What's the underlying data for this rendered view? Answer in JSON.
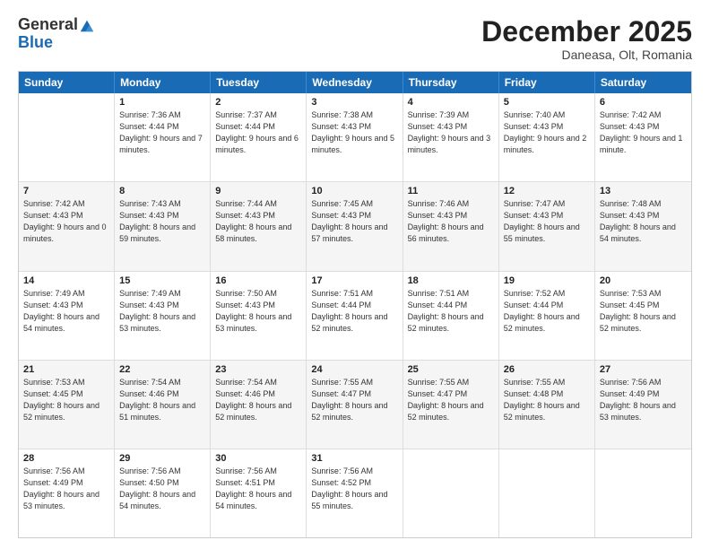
{
  "header": {
    "logo_general": "General",
    "logo_blue": "Blue",
    "month_title": "December 2025",
    "location": "Daneasa, Olt, Romania"
  },
  "days_of_week": [
    "Sunday",
    "Monday",
    "Tuesday",
    "Wednesday",
    "Thursday",
    "Friday",
    "Saturday"
  ],
  "weeks": [
    [
      {
        "day": "",
        "sunrise": "",
        "sunset": "",
        "daylight": ""
      },
      {
        "day": "1",
        "sunrise": "Sunrise: 7:36 AM",
        "sunset": "Sunset: 4:44 PM",
        "daylight": "Daylight: 9 hours and 7 minutes."
      },
      {
        "day": "2",
        "sunrise": "Sunrise: 7:37 AM",
        "sunset": "Sunset: 4:44 PM",
        "daylight": "Daylight: 9 hours and 6 minutes."
      },
      {
        "day": "3",
        "sunrise": "Sunrise: 7:38 AM",
        "sunset": "Sunset: 4:43 PM",
        "daylight": "Daylight: 9 hours and 5 minutes."
      },
      {
        "day": "4",
        "sunrise": "Sunrise: 7:39 AM",
        "sunset": "Sunset: 4:43 PM",
        "daylight": "Daylight: 9 hours and 3 minutes."
      },
      {
        "day": "5",
        "sunrise": "Sunrise: 7:40 AM",
        "sunset": "Sunset: 4:43 PM",
        "daylight": "Daylight: 9 hours and 2 minutes."
      },
      {
        "day": "6",
        "sunrise": "Sunrise: 7:42 AM",
        "sunset": "Sunset: 4:43 PM",
        "daylight": "Daylight: 9 hours and 1 minute."
      }
    ],
    [
      {
        "day": "7",
        "sunrise": "Sunrise: 7:42 AM",
        "sunset": "Sunset: 4:43 PM",
        "daylight": "Daylight: 9 hours and 0 minutes."
      },
      {
        "day": "8",
        "sunrise": "Sunrise: 7:43 AM",
        "sunset": "Sunset: 4:43 PM",
        "daylight": "Daylight: 8 hours and 59 minutes."
      },
      {
        "day": "9",
        "sunrise": "Sunrise: 7:44 AM",
        "sunset": "Sunset: 4:43 PM",
        "daylight": "Daylight: 8 hours and 58 minutes."
      },
      {
        "day": "10",
        "sunrise": "Sunrise: 7:45 AM",
        "sunset": "Sunset: 4:43 PM",
        "daylight": "Daylight: 8 hours and 57 minutes."
      },
      {
        "day": "11",
        "sunrise": "Sunrise: 7:46 AM",
        "sunset": "Sunset: 4:43 PM",
        "daylight": "Daylight: 8 hours and 56 minutes."
      },
      {
        "day": "12",
        "sunrise": "Sunrise: 7:47 AM",
        "sunset": "Sunset: 4:43 PM",
        "daylight": "Daylight: 8 hours and 55 minutes."
      },
      {
        "day": "13",
        "sunrise": "Sunrise: 7:48 AM",
        "sunset": "Sunset: 4:43 PM",
        "daylight": "Daylight: 8 hours and 54 minutes."
      }
    ],
    [
      {
        "day": "14",
        "sunrise": "Sunrise: 7:49 AM",
        "sunset": "Sunset: 4:43 PM",
        "daylight": "Daylight: 8 hours and 54 minutes."
      },
      {
        "day": "15",
        "sunrise": "Sunrise: 7:49 AM",
        "sunset": "Sunset: 4:43 PM",
        "daylight": "Daylight: 8 hours and 53 minutes."
      },
      {
        "day": "16",
        "sunrise": "Sunrise: 7:50 AM",
        "sunset": "Sunset: 4:43 PM",
        "daylight": "Daylight: 8 hours and 53 minutes."
      },
      {
        "day": "17",
        "sunrise": "Sunrise: 7:51 AM",
        "sunset": "Sunset: 4:44 PM",
        "daylight": "Daylight: 8 hours and 52 minutes."
      },
      {
        "day": "18",
        "sunrise": "Sunrise: 7:51 AM",
        "sunset": "Sunset: 4:44 PM",
        "daylight": "Daylight: 8 hours and 52 minutes."
      },
      {
        "day": "19",
        "sunrise": "Sunrise: 7:52 AM",
        "sunset": "Sunset: 4:44 PM",
        "daylight": "Daylight: 8 hours and 52 minutes."
      },
      {
        "day": "20",
        "sunrise": "Sunrise: 7:53 AM",
        "sunset": "Sunset: 4:45 PM",
        "daylight": "Daylight: 8 hours and 52 minutes."
      }
    ],
    [
      {
        "day": "21",
        "sunrise": "Sunrise: 7:53 AM",
        "sunset": "Sunset: 4:45 PM",
        "daylight": "Daylight: 8 hours and 52 minutes."
      },
      {
        "day": "22",
        "sunrise": "Sunrise: 7:54 AM",
        "sunset": "Sunset: 4:46 PM",
        "daylight": "Daylight: 8 hours and 51 minutes."
      },
      {
        "day": "23",
        "sunrise": "Sunrise: 7:54 AM",
        "sunset": "Sunset: 4:46 PM",
        "daylight": "Daylight: 8 hours and 52 minutes."
      },
      {
        "day": "24",
        "sunrise": "Sunrise: 7:55 AM",
        "sunset": "Sunset: 4:47 PM",
        "daylight": "Daylight: 8 hours and 52 minutes."
      },
      {
        "day": "25",
        "sunrise": "Sunrise: 7:55 AM",
        "sunset": "Sunset: 4:47 PM",
        "daylight": "Daylight: 8 hours and 52 minutes."
      },
      {
        "day": "26",
        "sunrise": "Sunrise: 7:55 AM",
        "sunset": "Sunset: 4:48 PM",
        "daylight": "Daylight: 8 hours and 52 minutes."
      },
      {
        "day": "27",
        "sunrise": "Sunrise: 7:56 AM",
        "sunset": "Sunset: 4:49 PM",
        "daylight": "Daylight: 8 hours and 53 minutes."
      }
    ],
    [
      {
        "day": "28",
        "sunrise": "Sunrise: 7:56 AM",
        "sunset": "Sunset: 4:49 PM",
        "daylight": "Daylight: 8 hours and 53 minutes."
      },
      {
        "day": "29",
        "sunrise": "Sunrise: 7:56 AM",
        "sunset": "Sunset: 4:50 PM",
        "daylight": "Daylight: 8 hours and 54 minutes."
      },
      {
        "day": "30",
        "sunrise": "Sunrise: 7:56 AM",
        "sunset": "Sunset: 4:51 PM",
        "daylight": "Daylight: 8 hours and 54 minutes."
      },
      {
        "day": "31",
        "sunrise": "Sunrise: 7:56 AM",
        "sunset": "Sunset: 4:52 PM",
        "daylight": "Daylight: 8 hours and 55 minutes."
      },
      {
        "day": "",
        "sunrise": "",
        "sunset": "",
        "daylight": ""
      },
      {
        "day": "",
        "sunrise": "",
        "sunset": "",
        "daylight": ""
      },
      {
        "day": "",
        "sunrise": "",
        "sunset": "",
        "daylight": ""
      }
    ]
  ]
}
